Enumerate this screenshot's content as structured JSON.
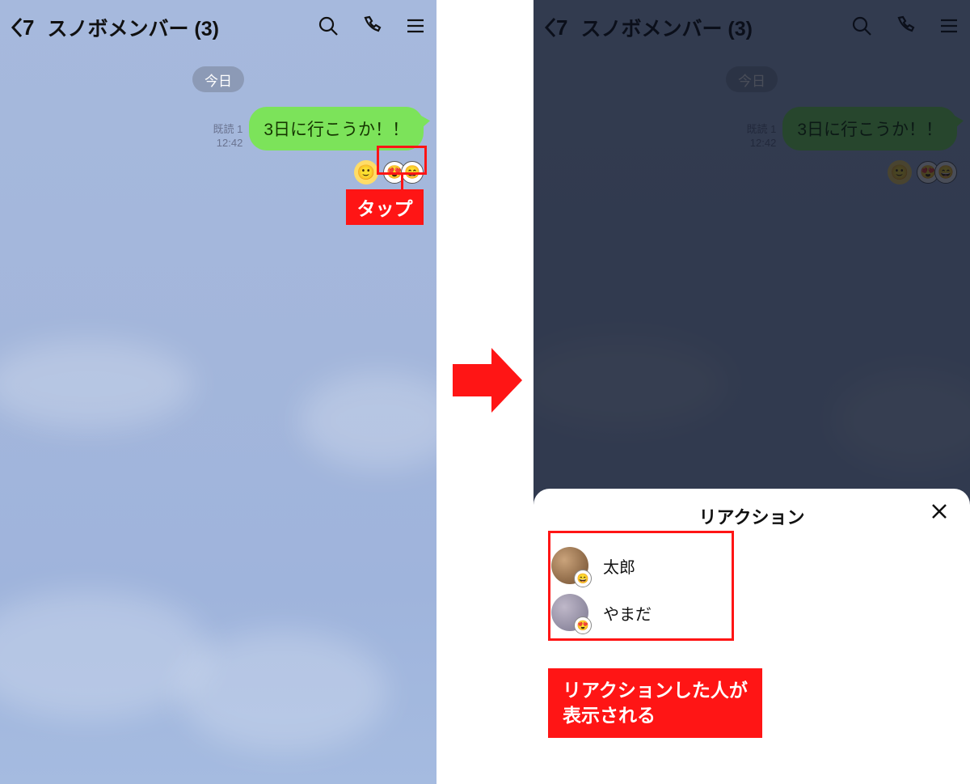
{
  "header": {
    "badge": "7",
    "title": "スノボメンバー (3)"
  },
  "chat": {
    "date_label": "今日",
    "read_label": "既読 1",
    "time": "12:42",
    "message": "3日に行こうか！！"
  },
  "annotations": {
    "tap_label": "タップ",
    "explain": "リアクションした人が\n表示される"
  },
  "sheet": {
    "title": "リアクション",
    "users": [
      {
        "name": "太郎",
        "reaction": "laugh"
      },
      {
        "name": "やまだ",
        "reaction": "heart-eyes"
      }
    ]
  },
  "emojis": {
    "smile": "🙂",
    "heart-eyes": "😍",
    "laugh": "😄"
  }
}
